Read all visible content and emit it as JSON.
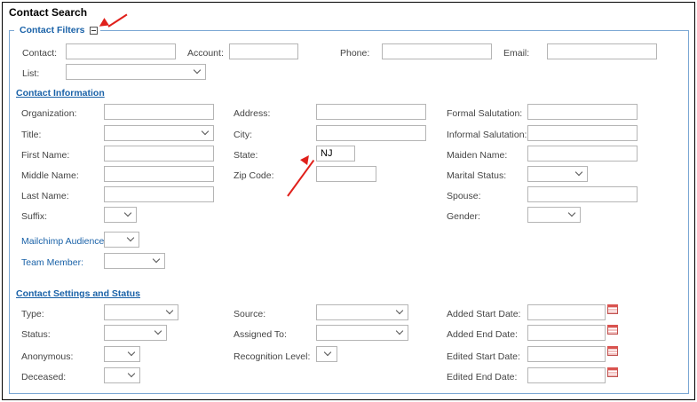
{
  "page_title": "Contact Search",
  "filters_legend": "Contact Filters",
  "top": {
    "contact_label": "Contact:",
    "account_label": "Account:",
    "phone_label": "Phone:",
    "email_label": "Email:",
    "list_label": "List:"
  },
  "contact_info": {
    "heading": "Contact Information",
    "organization_label": "Organization:",
    "title_label": "Title:",
    "first_name_label": "First Name:",
    "middle_name_label": "Middle Name:",
    "last_name_label": "Last Name:",
    "suffix_label": "Suffix:",
    "mailchimp_label": "Mailchimp Audience:",
    "team_member_label": "Team Member:",
    "address_label": "Address:",
    "city_label": "City:",
    "state_label": "State:",
    "state_value": "NJ",
    "zip_label": "Zip Code:",
    "formal_salutation_label": "Formal Salutation:",
    "informal_salutation_label": "Informal Salutation:",
    "maiden_name_label": "Maiden Name:",
    "marital_status_label": "Marital Status:",
    "spouse_label": "Spouse:",
    "gender_label": "Gender:"
  },
  "settings": {
    "heading": "Contact Settings and Status",
    "type_label": "Type:",
    "status_label": "Status:",
    "anonymous_label": "Anonymous:",
    "deceased_label": "Deceased:",
    "source_label": "Source:",
    "assigned_to_label": "Assigned To:",
    "recognition_level_label": "Recognition Level:",
    "added_start_label": "Added Start Date:",
    "added_end_label": "Added End Date:",
    "edited_start_label": "Edited Start Date:",
    "edited_end_label": "Edited End Date:"
  },
  "icons": {
    "calendar": "calendar-icon",
    "collapse": "collapse-icon",
    "chevron": "chevron-down-icon"
  },
  "colors": {
    "link": "#1a62a8",
    "fieldset_border": "#7aa7d3",
    "annotation_arrow": "#e0201b"
  }
}
